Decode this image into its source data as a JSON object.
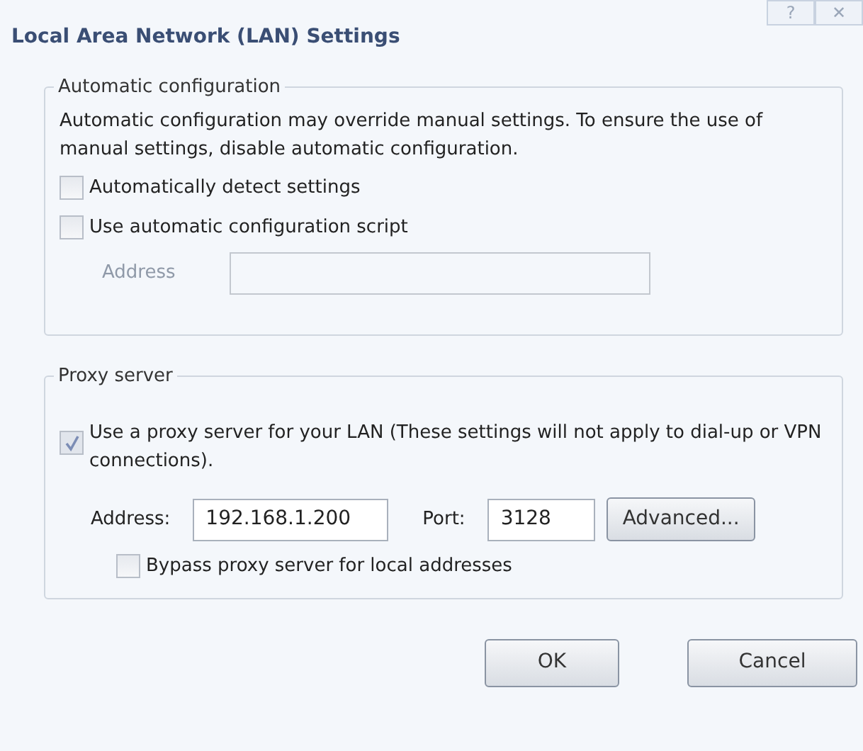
{
  "window": {
    "title": "Local Area Network (LAN) Settings",
    "controls": [
      "?",
      "✕"
    ]
  },
  "automatic_configuration": {
    "legend": "Automatic configuration",
    "description": "Automatic configuration may override manual settings.  To ensure the use of manual settings, disable automatic configuration.",
    "options": [
      {
        "label": "Automatically detect settings",
        "checked": false
      },
      {
        "label": "Use automatic configuration script",
        "checked": false
      }
    ],
    "script_address": {
      "label": "Address",
      "disabled": true
    }
  },
  "proxy_server": {
    "legend": "Proxy server",
    "use_proxy": {
      "label": "Use a proxy server for your LAN (These settings will not apply to dial-up or VPN connections).",
      "checked": true,
      "disabled": true
    },
    "address": {
      "label": "Address:",
      "value": "192.168.1.200"
    },
    "port": {
      "label": "Port:",
      "value": "3128"
    },
    "advanced_button": "Advanced...",
    "bypass": {
      "label": "Bypass proxy server for local addresses",
      "checked": false
    }
  },
  "buttons": [
    "OK",
    "Cancel"
  ]
}
